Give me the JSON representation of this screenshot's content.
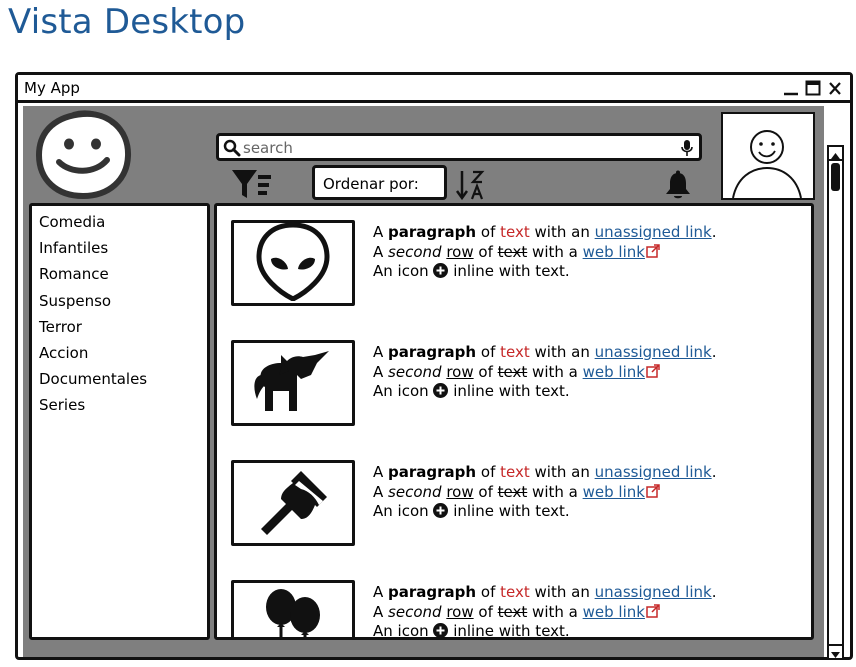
{
  "page": {
    "title": "Vista Desktop"
  },
  "window": {
    "title": "My App",
    "controls": [
      "minimize-icon",
      "maximize-icon",
      "close-icon"
    ]
  },
  "search": {
    "placeholder": "search",
    "value": ""
  },
  "toolbar": {
    "sort_label": "Ordenar por:"
  },
  "sidebar": {
    "items": [
      {
        "label": "Comedia"
      },
      {
        "label": "Infantiles"
      },
      {
        "label": "Romance"
      },
      {
        "label": "Suspenso"
      },
      {
        "label": "Terror"
      },
      {
        "label": "Accion"
      },
      {
        "label": "Documentales"
      },
      {
        "label": "Series"
      }
    ]
  },
  "list": {
    "items": [
      {
        "icon": "alien-icon"
      },
      {
        "icon": "unicorn-icon"
      },
      {
        "icon": "axe-icon"
      },
      {
        "icon": "balloons-icon"
      }
    ],
    "text": {
      "a": "A",
      "paragraph": "paragraph",
      "of": "of",
      "text": "text",
      "with_an": "with an",
      "unassigned_link": "unassigned link",
      "period": ".",
      "second": "second",
      "row": "row",
      "with_a": "with a",
      "web_link": "web link",
      "an_icon": "An icon",
      "inline_with_text": "inline with text."
    }
  },
  "colors": {
    "title_blue": "#1f5a96",
    "workspace_gray": "#7f7f7f",
    "text_red": "#c62828",
    "link_blue": "#1f5a96"
  }
}
